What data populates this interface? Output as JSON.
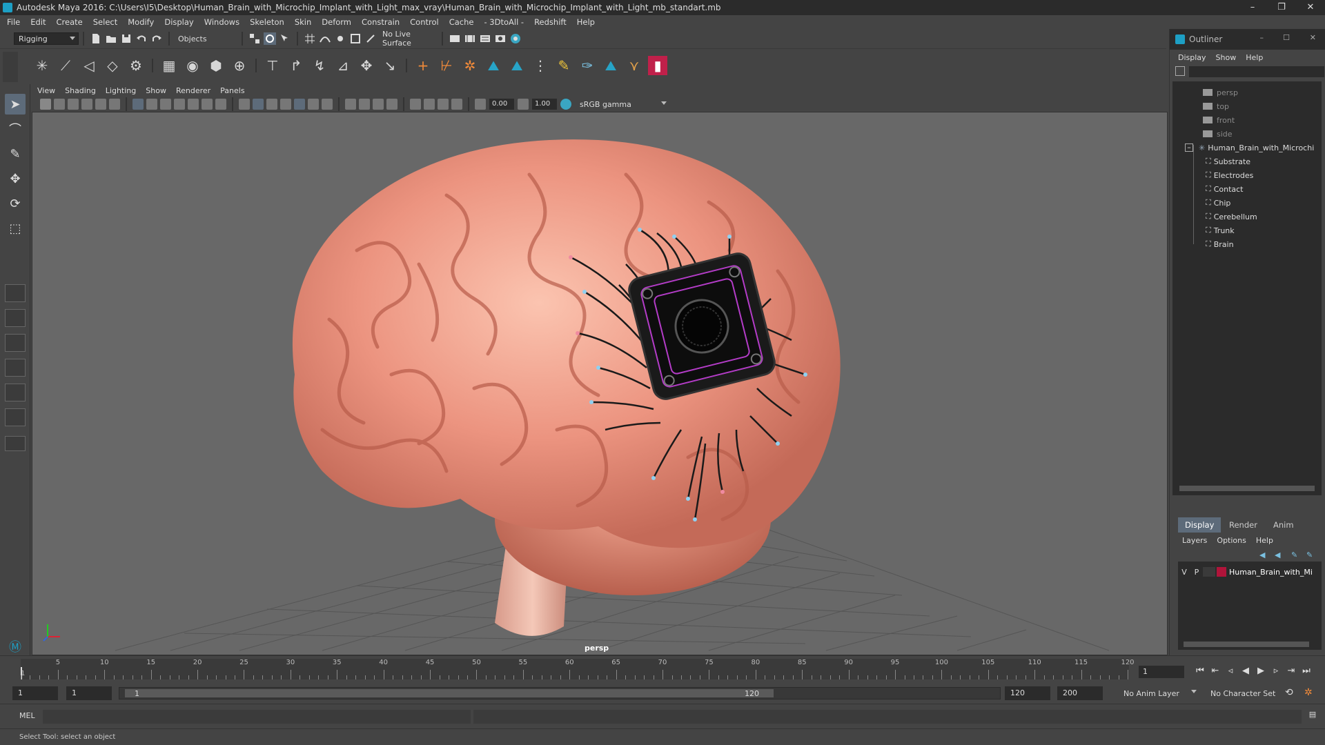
{
  "app": {
    "title": "Autodesk Maya 2016: C:\\Users\\I5\\Desktop\\Human_Brain_with_Microchip_Implant_with_Light_max_vray\\Human_Brain_with_Microchip_Implant_with_Light_mb_standart.mb",
    "window_buttons": [
      "–",
      "❐",
      "✕"
    ]
  },
  "menubar": [
    "File",
    "Edit",
    "Create",
    "Select",
    "Modify",
    "Display",
    "Windows",
    "Skeleton",
    "Skin",
    "Deform",
    "Constrain",
    "Control",
    "Cache",
    "- 3DtoAll -",
    "Redshift",
    "Help"
  ],
  "statusline": {
    "menuset": "Rigging",
    "selection_mode": "Objects",
    "live_surface": "No Live Surface"
  },
  "viewport": {
    "menu": [
      "View",
      "Shading",
      "Lighting",
      "Show",
      "Renderer",
      "Panels"
    ],
    "exposure": "0.00",
    "gamma": "1.00",
    "colorspace": "sRGB gamma",
    "camera": "persp"
  },
  "outliner": {
    "title": "Outliner",
    "menu": [
      "Display",
      "Show",
      "Help"
    ],
    "cameras": [
      "persp",
      "top",
      "front",
      "side"
    ],
    "group": "Human_Brain_with_Microchi",
    "children": [
      "Substrate",
      "Electrodes",
      "Contact",
      "Chip",
      "Cerebellum",
      "Trunk",
      "Brain"
    ]
  },
  "layer_panel": {
    "tabs": [
      "Display",
      "Render",
      "Anim"
    ],
    "active_tab": "Display",
    "menu": [
      "Layers",
      "Options",
      "Help"
    ],
    "layer": {
      "v": "V",
      "p": "P",
      "name": "Human_Brain_with_Mi",
      "color": "#b0143a"
    }
  },
  "timeline": {
    "ticks": [
      "5",
      "10",
      "15",
      "20",
      "25",
      "30",
      "35",
      "40",
      "45",
      "50",
      "55",
      "60",
      "65",
      "70",
      "75",
      "80",
      "85",
      "90",
      "95",
      "100",
      "105",
      "110",
      "115",
      "120"
    ],
    "start_label": "1",
    "current_frame": "1"
  },
  "range": {
    "start": "1",
    "playback_start": "1",
    "range_start": "1",
    "range_end": "120",
    "playback_end": "120",
    "end": "200",
    "anim_layer": "No Anim Layer",
    "character_set": "No Character Set"
  },
  "cmdline": {
    "label": "MEL"
  },
  "helpline": {
    "text": "Select Tool: select an object"
  },
  "colors": {
    "accent": "#5d6b7a",
    "brain": "#e8957e",
    "chip": "#1a1a1a",
    "chip_glow": "#b43cc8"
  }
}
